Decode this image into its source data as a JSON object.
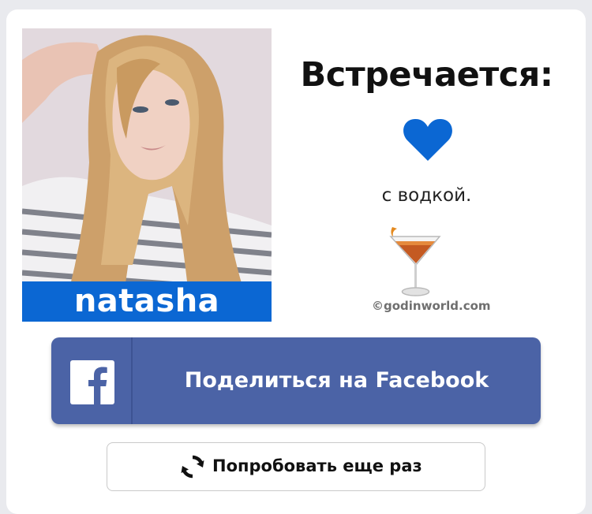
{
  "result_card": {
    "name": "natasha",
    "heading": "Встречается:",
    "subtext": "с водкой.",
    "watermark": "©godinworld.com"
  },
  "icons": {
    "heart": "heart-icon",
    "cocktail": "cocktail-glass-icon",
    "facebook": "facebook-logo-icon",
    "retry": "refresh-icon"
  },
  "actions": {
    "share_facebook_label": "Поделиться на Facebook",
    "try_again_label": "Попробовать еще раз"
  },
  "colors": {
    "name_bar": "#0b67d3",
    "heart": "#0b67d3",
    "facebook_button": "#4b63a6"
  }
}
